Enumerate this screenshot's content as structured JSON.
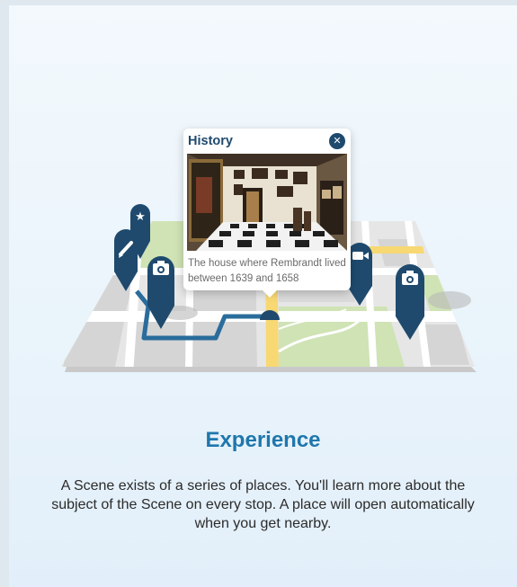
{
  "popup": {
    "title": "History",
    "caption": "The house where Rembrandt lived between 1639 and 1658",
    "close_icon": "close-icon",
    "image_subject": "museum-interior-image"
  },
  "markers": [
    {
      "icon": "star-icon"
    },
    {
      "icon": "pencil-icon"
    },
    {
      "icon": "camera-icon"
    },
    {
      "icon": "video-camera-icon"
    },
    {
      "icon": "camera-icon"
    }
  ],
  "intro": {
    "heading": "Experience",
    "description": "A Scene exists of a series of places. You'll learn more about the subject of the Scene on every stop. A place will open automatically when you get nearby."
  },
  "colors": {
    "accent": "#1f77ad",
    "marker": "#1f4a6e",
    "route": "#2a6c9b",
    "map_park": "#cfe3b5",
    "map_road_highlight": "#f7d873"
  }
}
